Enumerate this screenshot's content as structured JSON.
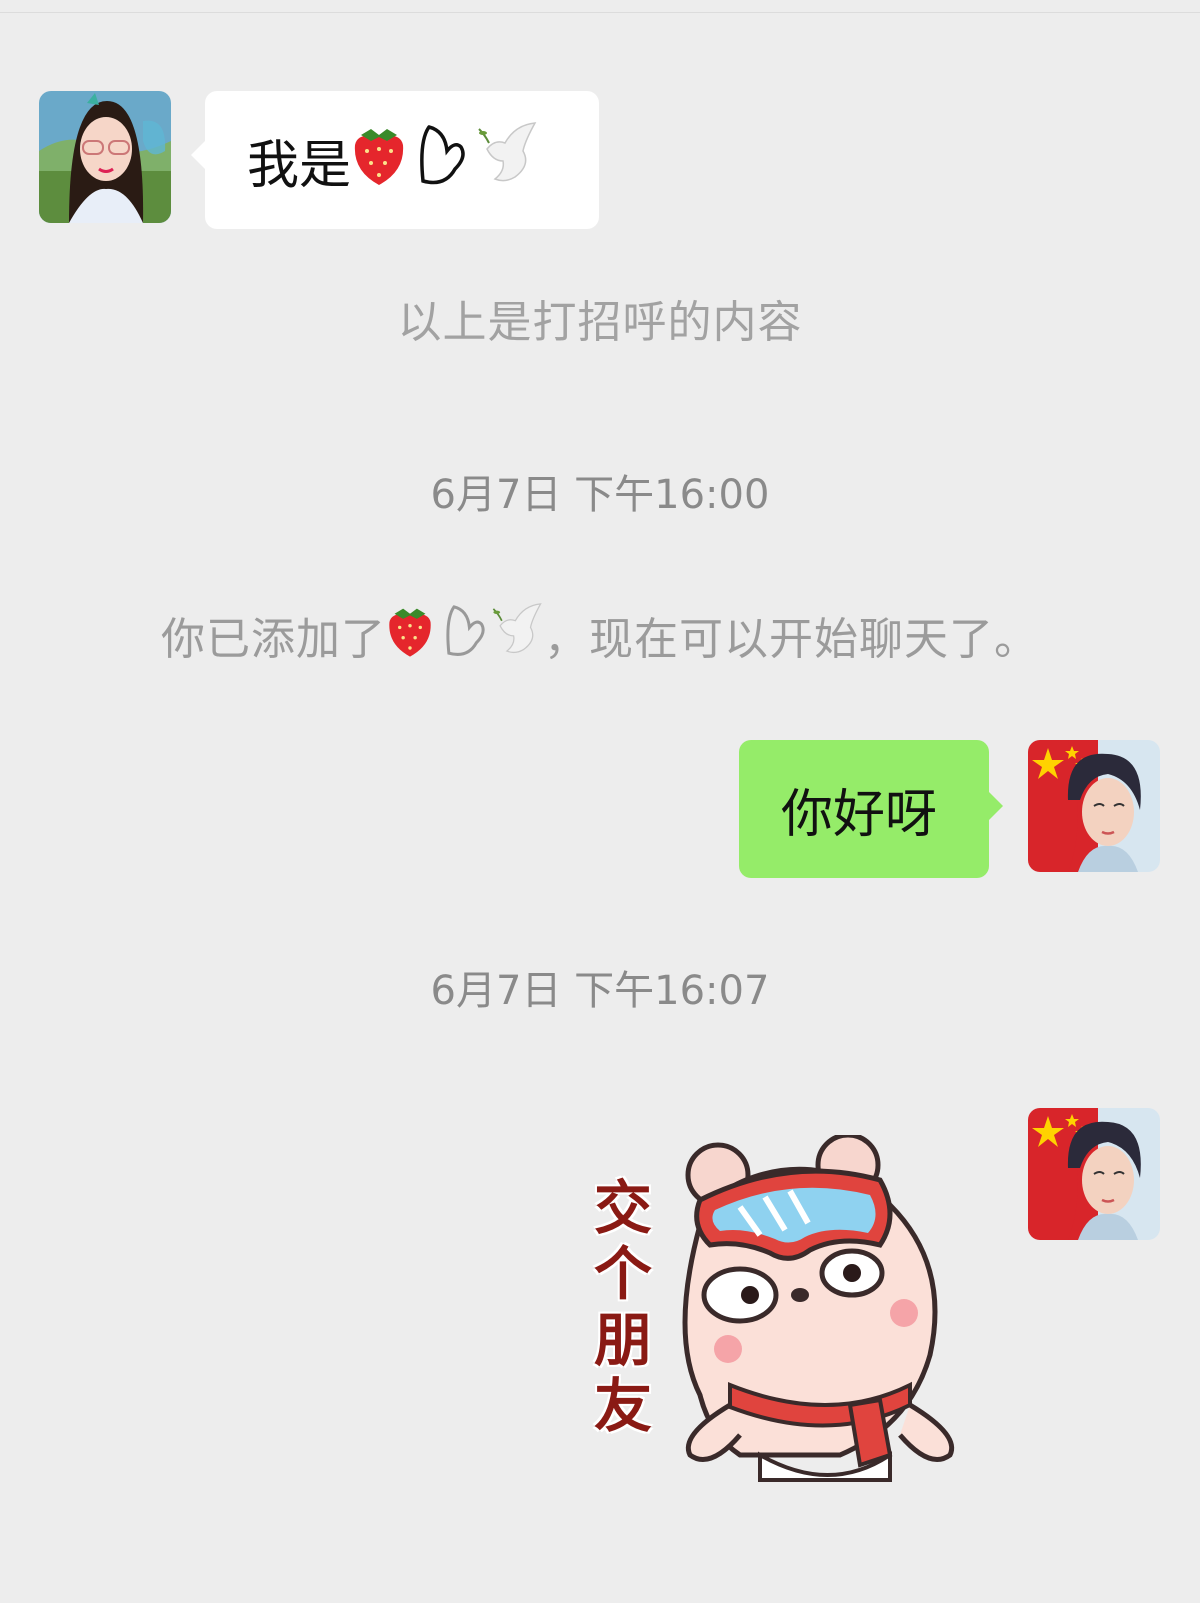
{
  "messages": {
    "greeting": {
      "text": "我是"
    },
    "greeting_note": {
      "text": "以上是打招呼的内容"
    },
    "time1": {
      "text": "6月7日 下午16:00"
    },
    "added_notice": {
      "prefix": "你已添加了",
      "suffix": "，现在可以开始聊天了。"
    },
    "hello": {
      "text": "你好呀"
    },
    "time2": {
      "text": "6月7日 下午16:07"
    },
    "sticker": {
      "caption": "交个朋友"
    }
  },
  "colors": {
    "background": "#ededed",
    "incoming_bubble": "#ffffff",
    "outgoing_bubble": "#95ec69",
    "system_text": "#9b9b9b"
  },
  "icons": {
    "contact_name_icons": [
      "strawberry-icon",
      "heart-doodle-icon",
      "dove-icon"
    ],
    "contact_avatar": "girl-with-glasses-avatar",
    "self_avatar": "boy-with-flag-avatar"
  }
}
